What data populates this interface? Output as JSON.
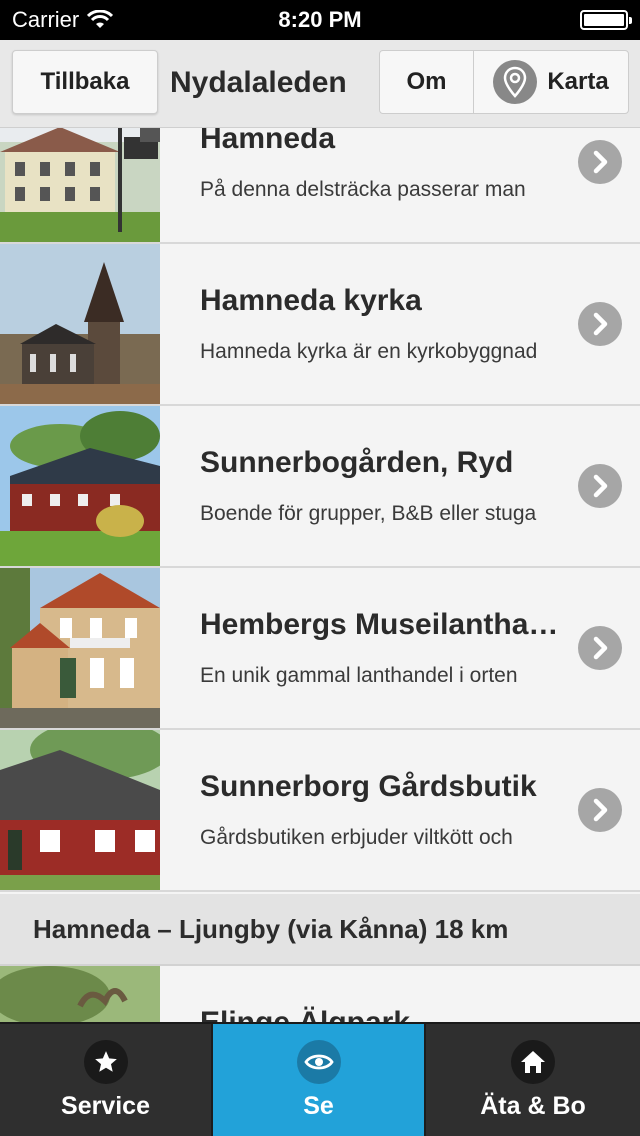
{
  "status": {
    "carrier": "Carrier",
    "time": "8:20 PM"
  },
  "nav": {
    "back_label": "Tillbaka",
    "title": "Nydalaleden",
    "om_label": "Om",
    "karta_label": "Karta"
  },
  "rows": [
    {
      "title": "Hamneda",
      "desc": "På denna delsträcka passerar man"
    },
    {
      "title": "Hamneda kyrka",
      "desc": "Hamneda kyrka är en kyrkobyggnad"
    },
    {
      "title": "Sunnerbogården, Ryd",
      "desc": "Boende för grupper, B&B eller stuga"
    },
    {
      "title": "Hembergs Museilanthandel",
      "desc": "En unik gammal lanthandel i orten"
    },
    {
      "title": "Sunnerborg Gårdsbutik",
      "desc": "Gårdsbutiken erbjuder viltkött och"
    }
  ],
  "section": {
    "label": "Hamneda – Ljungby (via Kånna) 18 km"
  },
  "partial_row": {
    "title": "Elinge Älgpark"
  },
  "tabs": [
    {
      "label": "Service",
      "icon": "star-icon"
    },
    {
      "label": "Se",
      "icon": "eye-icon"
    },
    {
      "label": "Äta & Bo",
      "icon": "home-icon"
    }
  ],
  "colors": {
    "accent": "#22a2d9",
    "tab_bar": "#2f2f2f",
    "chevron": "#a6a6a6"
  }
}
